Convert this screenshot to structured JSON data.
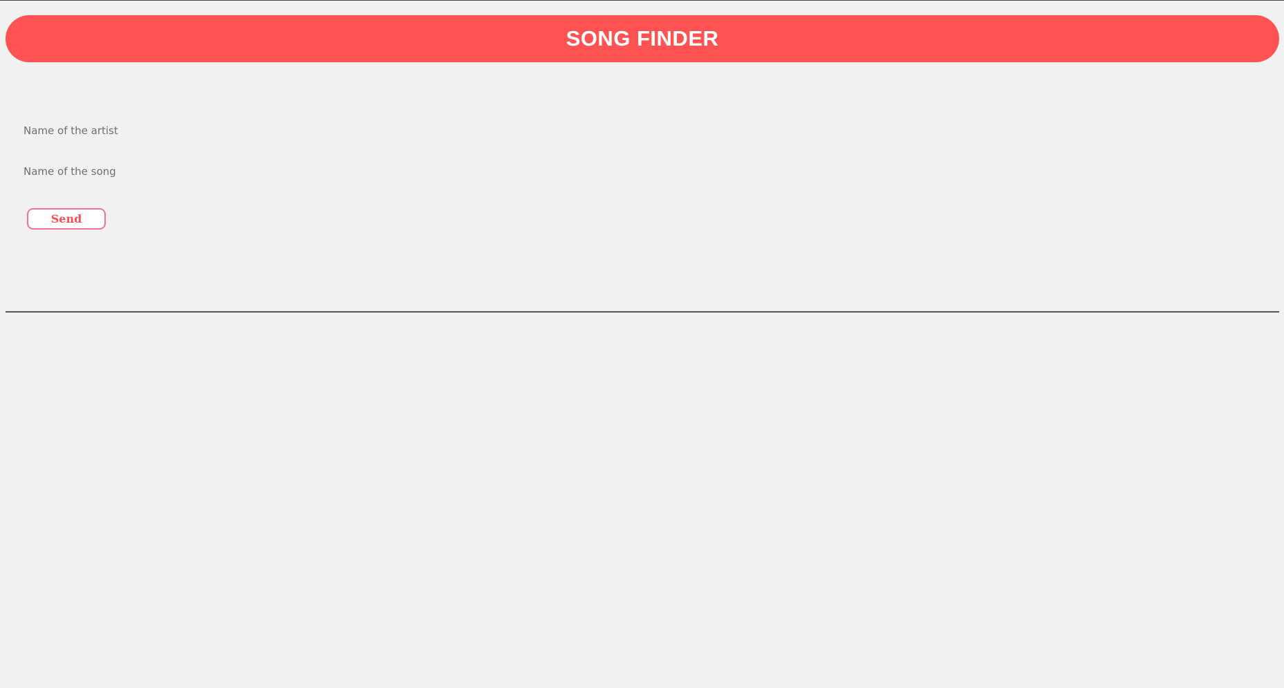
{
  "header": {
    "title": "SONG FINDER"
  },
  "form": {
    "artist_placeholder": "Name of the artist",
    "artist_value": "",
    "song_placeholder": "Name of the song",
    "song_value": "",
    "send_label": "Send"
  },
  "colors": {
    "background": "#f1f1f1",
    "header_bg": "#ff5353",
    "header_text": "#ffffff",
    "button_border": "#f0709a",
    "button_text": "#ff4d4d",
    "placeholder_text": "#6f6f6f"
  }
}
